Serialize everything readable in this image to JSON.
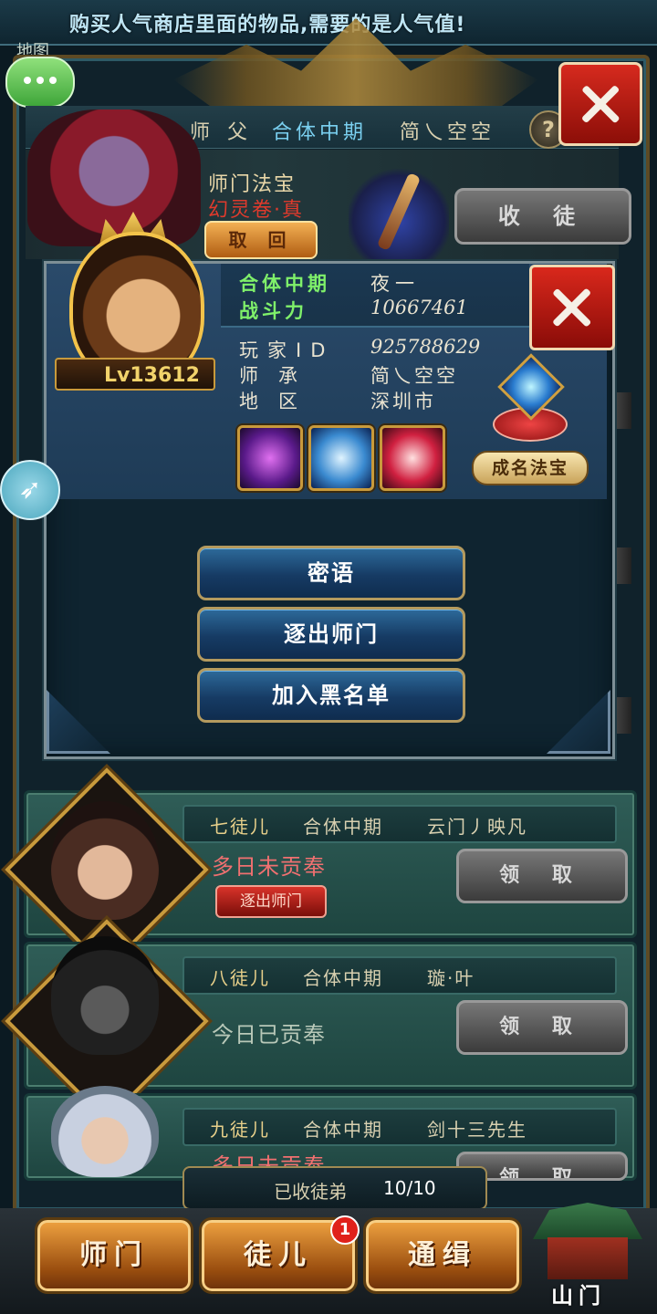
{
  "marquee": {
    "text": "购买人气商店里面的物品,需要的是人气值!"
  },
  "map_label": "地图",
  "master": {
    "role": "师 父",
    "realm": "合体中期",
    "name": "简乀空空",
    "help": "?"
  },
  "treasure": {
    "title": "师门法宝",
    "name": "幻灵卷·真",
    "retrieve_label": "取 回",
    "recruit_label": "收 徒"
  },
  "profile": {
    "realm": "合体中期",
    "name": "夜一",
    "power_label": "战斗力",
    "power_value": "10667461",
    "level": "Lv13612",
    "info": [
      {
        "label": "玩家ID",
        "value": "925788629"
      },
      {
        "label": "师承",
        "value": "简乀空空"
      },
      {
        "label": "地区",
        "value": "深圳市"
      }
    ],
    "skills": [
      "purple-rose-skill",
      "blue-sword-skill",
      "red-vortex-skill"
    ],
    "famous_treasure_label": "成名法宝"
  },
  "actions": {
    "whisper": "密语",
    "expel": "逐出师门",
    "blacklist": "加入黑名单"
  },
  "disciples": [
    {
      "rank": "七徒儿",
      "realm": "合体中期",
      "name": "云门丿映凡",
      "status": "多日未贡奉",
      "status_color": "#f07070",
      "expel_label": "逐出师门",
      "claim_label": "领 取"
    },
    {
      "rank": "八徒儿",
      "realm": "合体中期",
      "name": "璇·叶",
      "status": "今日已贡奉",
      "status_color": "#b8c8b8",
      "claim_label": "领 取"
    },
    {
      "rank": "九徒儿",
      "realm": "合体中期",
      "name": "剑十三先生",
      "status": "多日未贡奉",
      "status_color": "#f07070",
      "claim_label": "领 取"
    }
  ],
  "disciple_count": {
    "label": "已收徒弟",
    "value": "10/10"
  },
  "tabs": [
    {
      "label": "师门"
    },
    {
      "label": "徒儿",
      "badge": "1"
    },
    {
      "label": "通缉"
    }
  ],
  "gate_label": "山门",
  "colors": {
    "accent_green": "#7ff06a",
    "warning_red": "#e03a2c",
    "gold": "#c89a3c"
  }
}
